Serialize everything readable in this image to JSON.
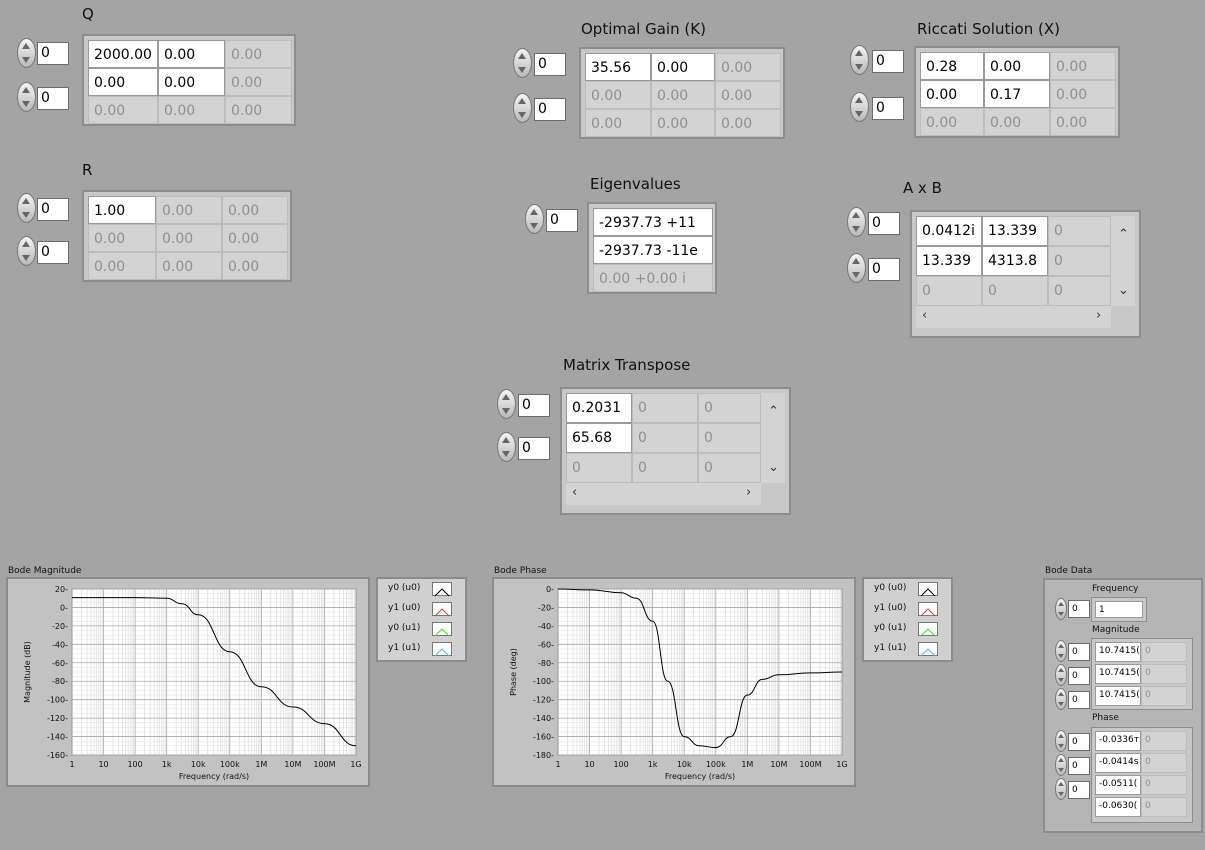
{
  "q": {
    "title": "Q",
    "index_row": "0",
    "index_col": "0",
    "cells": [
      [
        "2000.00",
        "0.00",
        "0.00"
      ],
      [
        "0.00",
        "0.00",
        "0.00"
      ],
      [
        "0.00",
        "0.00",
        "0.00"
      ]
    ]
  },
  "r": {
    "title": "R",
    "index_row": "0",
    "index_col": "0",
    "cells": [
      [
        "1.00",
        "0.00",
        "0.00"
      ],
      [
        "0.00",
        "0.00",
        "0.00"
      ],
      [
        "0.00",
        "0.00",
        "0.00"
      ]
    ]
  },
  "k": {
    "title": "Optimal Gain (K)",
    "index_row": "0",
    "index_col": "0",
    "cells": [
      [
        "35.56",
        "0.00",
        "0.00"
      ],
      [
        "0.00",
        "0.00",
        "0.00"
      ],
      [
        "0.00",
        "0.00",
        "0.00"
      ]
    ]
  },
  "x": {
    "title": "Riccati Solution (X)",
    "index_row": "0",
    "index_col": "0",
    "cells": [
      [
        "0.28",
        "0.00",
        "0.00"
      ],
      [
        "0.00",
        "0.17",
        "0.00"
      ],
      [
        "0.00",
        "0.00",
        "0.00"
      ]
    ]
  },
  "eig": {
    "title": "Eigenvalues",
    "index": "0",
    "cells": [
      "-2937.73 +11",
      "-2937.73 -11е",
      "0.00 +0.00 i"
    ]
  },
  "axb": {
    "title": "A x B",
    "index_row": "0",
    "index_col": "0",
    "cells": [
      [
        "0.0412і",
        "13.339",
        "0"
      ],
      [
        "13.339",
        "4313.8",
        "0"
      ],
      [
        "0",
        "0",
        "0"
      ]
    ]
  },
  "mt": {
    "title": "Matrix Transpose",
    "index_row": "0",
    "index_col": "0",
    "cells": [
      [
        "0.2031",
        "0",
        "0"
      ],
      [
        "65.68",
        "0",
        "0"
      ],
      [
        "0",
        "0",
        "0"
      ]
    ]
  },
  "bode_mag": {
    "title": "Bode Magnitude",
    "ylabel": "Magnitude (dB)",
    "xlabel": "Frequency (rad/s)",
    "yticks": [
      "20",
      "0",
      "-20",
      "-40",
      "-60",
      "-80",
      "-100",
      "-120",
      "-140",
      "-160"
    ],
    "xticks": [
      "1",
      "10",
      "100",
      "1k",
      "10k",
      "100k",
      "1M",
      "10M",
      "100M",
      "1G"
    ]
  },
  "bode_phase": {
    "title": "Bode Phase",
    "ylabel": "Phase (deg)",
    "xlabel": "Frequency (rad/s)",
    "yticks": [
      "0",
      "-20",
      "-40",
      "-60",
      "-80",
      "-100",
      "-120",
      "-140",
      "-160",
      "-180"
    ],
    "xticks": [
      "1",
      "10",
      "100",
      "1k",
      "10k",
      "100k",
      "1M",
      "10M",
      "100M",
      "1G"
    ]
  },
  "legend": [
    {
      "label": "y0 (u0)",
      "color": "#000000"
    },
    {
      "label": "y1 (u0)",
      "color": "#e53b3b"
    },
    {
      "label": "y0 (u1)",
      "color": "#2fe02f"
    },
    {
      "label": "y1 (u1)",
      "color": "#48b8f0"
    }
  ],
  "bode_data": {
    "title": "Bode Data",
    "index": "0",
    "frequency_label": "Frequency",
    "frequency": "1",
    "magnitude_label": "Magnitude",
    "magnitude": [
      [
        "10.7415(",
        "0"
      ],
      [
        "10.7415(",
        "0"
      ],
      [
        "10.7415(",
        "0"
      ]
    ],
    "phase_label": "Phase",
    "phase": [
      [
        "-0.0336т",
        "0"
      ],
      [
        "-0.0414ѕ",
        "0"
      ],
      [
        "-0.0511(",
        "0"
      ],
      [
        "-0.0630(",
        "0"
      ]
    ],
    "mag_indices": [
      "0",
      "0",
      "0"
    ],
    "phase_indices": [
      "0",
      "0",
      "0"
    ]
  },
  "chart_data": [
    {
      "type": "line",
      "title": "Bode Magnitude",
      "xlabel": "Frequency (rad/s)",
      "ylabel": "Magnitude (dB)",
      "xscale": "log",
      "xlim": [
        1,
        1000000000
      ],
      "ylim": [
        -160,
        20
      ],
      "series": [
        {
          "name": "y0 (u0)",
          "x": [
            1,
            10,
            100,
            1000,
            3000,
            10000,
            100000,
            1000000,
            10000000,
            100000000,
            1000000000
          ],
          "y": [
            10.7,
            10.7,
            10.7,
            10,
            4,
            -8,
            -48,
            -86,
            -108,
            -126,
            -150
          ]
        }
      ]
    },
    {
      "type": "line",
      "title": "Bode Phase",
      "xlabel": "Frequency (rad/s)",
      "ylabel": "Phase (deg)",
      "xscale": "log",
      "xlim": [
        1,
        1000000000
      ],
      "ylim": [
        -180,
        0
      ],
      "series": [
        {
          "name": "y0 (u0)",
          "x": [
            1,
            10,
            100,
            300,
            1000,
            3000,
            10000,
            30000,
            100000,
            300000,
            1000000,
            3000000,
            10000000,
            100000000,
            1000000000
          ],
          "y": [
            0,
            -1,
            -4,
            -10,
            -35,
            -100,
            -160,
            -170,
            -172,
            -160,
            -115,
            -98,
            -93,
            -91,
            -90
          ]
        }
      ]
    }
  ]
}
